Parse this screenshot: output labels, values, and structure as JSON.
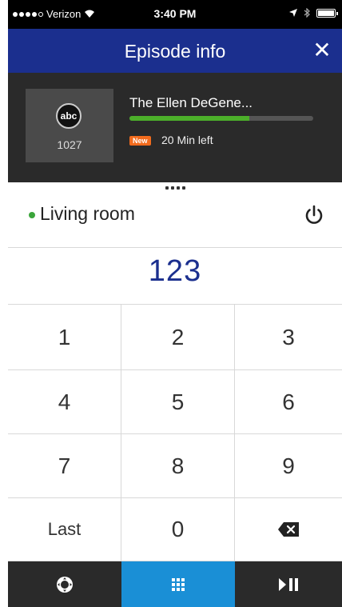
{
  "status_bar": {
    "carrier": "Verizon",
    "time": "3:40 PM"
  },
  "header": {
    "title": "Episode info",
    "close_label": "✕"
  },
  "now_playing": {
    "network_logo": "abc",
    "channel": "1027",
    "show_title": "The Ellen DeGene...",
    "progress_fraction": 0.65,
    "badge": "New",
    "time_left": "20 Min left",
    "colors": {
      "progress": "#4caf2a",
      "badge": "#f26b1d"
    }
  },
  "room": {
    "name": "Living room",
    "status_color": "#3ba53b",
    "power_icon": "power-icon"
  },
  "channel_entry": "123",
  "keypad": {
    "keys": [
      "1",
      "2",
      "3",
      "4",
      "5",
      "6",
      "7",
      "8",
      "9",
      "Last",
      "0"
    ],
    "backspace_icon": "backspace-icon"
  },
  "bottom_bar": {
    "items": [
      {
        "icon": "directional-pad-icon"
      },
      {
        "icon": "keypad-grid-icon",
        "active": true
      },
      {
        "icon": "play-pause-icon"
      }
    ],
    "active_color": "#1a8fd6"
  },
  "colors": {
    "header": "#1b2f8e",
    "accent_text": "#1b2f8e"
  }
}
